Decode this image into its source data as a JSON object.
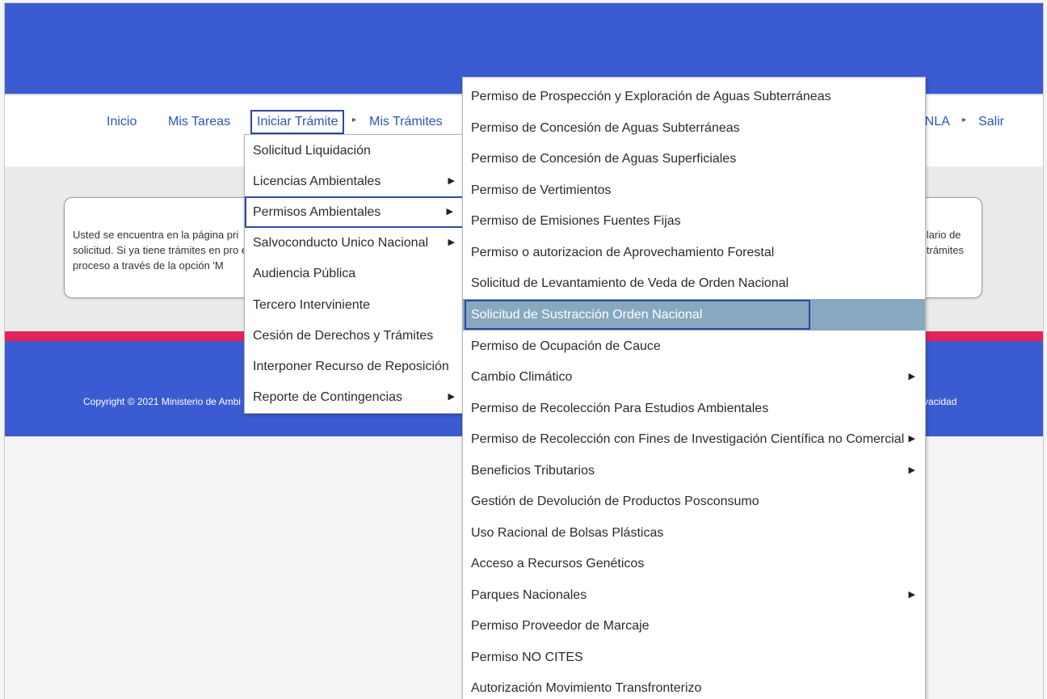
{
  "nav": {
    "items": [
      {
        "label": "Inicio"
      },
      {
        "label": "Mis Tareas"
      },
      {
        "label": "Iniciar Trámite"
      },
      {
        "label": "Mis Trámites"
      }
    ],
    "right_partial": "ANLA",
    "logout": "Salir"
  },
  "info": {
    "text_left": "Usted se encuentra en la página pri solicitud. Si ya tiene trámites en pro en proceso a través de la opción 'M",
    "text_right_1": "lario de",
    "text_right_2": "trámites"
  },
  "footer": {
    "copyright": "Copyright © 2021 Ministerio de Ambi",
    "right": "vacidad"
  },
  "menu_level1": [
    {
      "label": "Solicitud Liquidación",
      "submenu": false
    },
    {
      "label": "Licencias Ambientales",
      "submenu": true
    },
    {
      "label": "Permisos Ambientales",
      "submenu": true,
      "highlighted": true
    },
    {
      "label": "Salvoconducto Unico Nacional",
      "submenu": true
    },
    {
      "label": "Audiencia Pública",
      "submenu": false
    },
    {
      "label": "Tercero Interviniente",
      "submenu": false
    },
    {
      "label": "Cesión de Derechos y Trámites",
      "submenu": false
    },
    {
      "label": "Interponer Recurso de Reposición",
      "submenu": false
    },
    {
      "label": "Reporte de Contingencias",
      "submenu": true
    }
  ],
  "menu_level2": [
    {
      "label": "Permiso de Prospección y Exploración de Aguas Subterráneas",
      "submenu": false
    },
    {
      "label": "Permiso de Concesión de Aguas Subterráneas",
      "submenu": false
    },
    {
      "label": "Permiso de Concesión de Aguas Superficiales",
      "submenu": false
    },
    {
      "label": "Permiso de Vertimientos",
      "submenu": false
    },
    {
      "label": "Permiso de Emisiones Fuentes Fijas",
      "submenu": false
    },
    {
      "label": "Permiso o autorizacion de Aprovechamiento Forestal",
      "submenu": false
    },
    {
      "label": "Solicitud de Levantamiento de Veda de Orden Nacional",
      "submenu": false
    },
    {
      "label": "Solicitud de Sustracción Orden Nacional",
      "submenu": false,
      "selected": true
    },
    {
      "label": "Permiso de Ocupación de Cauce",
      "submenu": false
    },
    {
      "label": "Cambio Climático",
      "submenu": true
    },
    {
      "label": "Permiso de Recolección Para Estudios Ambientales",
      "submenu": false
    },
    {
      "label": "Permiso de Recolección con Fines de Investigación Científica no Comercial",
      "submenu": true
    },
    {
      "label": "Beneficios Tributarios",
      "submenu": true
    },
    {
      "label": "Gestión de Devolución de Productos Posconsumo",
      "submenu": false
    },
    {
      "label": "Uso Racional de Bolsas Plásticas",
      "submenu": false
    },
    {
      "label": "Acceso a Recursos Genéticos",
      "submenu": false
    },
    {
      "label": "Parques Nacionales",
      "submenu": true
    },
    {
      "label": "Permiso Proveedor de Marcaje",
      "submenu": false
    },
    {
      "label": "Permiso NO CITES",
      "submenu": false
    },
    {
      "label": "Autorización Movimiento Transfronterizo",
      "submenu": false
    }
  ],
  "icons": {
    "submenu_arrow": "chevron-right-icon",
    "nav_arrow": "chevron-right-icon"
  }
}
